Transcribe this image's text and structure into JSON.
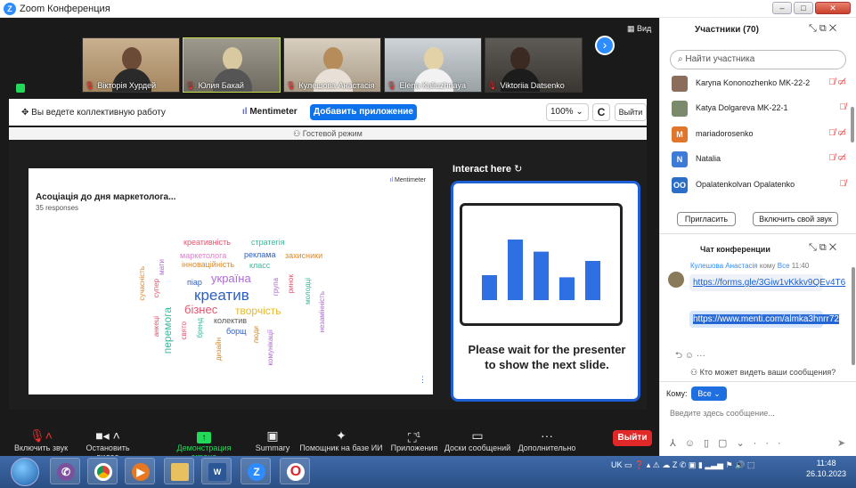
{
  "window": {
    "title": "Zoom Конференция",
    "buttons": [
      "–",
      "□",
      "✕"
    ]
  },
  "gallery": {
    "participants": [
      {
        "name": "Вікторія Хурдей"
      },
      {
        "name": "Юлия Бакай"
      },
      {
        "name": "Кулешова Анастасія"
      },
      {
        "name": "Elena Kaliuzhnaya"
      },
      {
        "name": "Viktoriia Datsenko"
      }
    ],
    "view_label": "Вид"
  },
  "collab": {
    "status_text": "Вы ведете коллективную работу",
    "app_name": "Mentimeter",
    "add_app_label": "Добавить приложение",
    "zoom_value": "100%",
    "exit_label": "Выйти",
    "guest_mode": "Гостевой режим"
  },
  "slide": {
    "brand": "Mentimeter",
    "title": "Асоціація до дня маркетолога...",
    "responses": "35 responses",
    "words": [
      {
        "text": "креатив",
        "color": "#2b5fc4"
      },
      {
        "text": "україна",
        "color": "#b06ad6"
      },
      {
        "text": "бізнес",
        "color": "#e2556d"
      },
      {
        "text": "творчість",
        "color": "#e6b830"
      },
      {
        "text": "перемога",
        "color": "#3cb89c"
      },
      {
        "text": "креативність",
        "color": "#e2556d"
      },
      {
        "text": "стратегія",
        "color": "#3cb89c"
      },
      {
        "text": "маркетолога",
        "color": "#e07bd0"
      },
      {
        "text": "реклама",
        "color": "#2b5fc4"
      },
      {
        "text": "захисники",
        "color": "#d98a2e"
      },
      {
        "text": "інноваційність",
        "color": "#d98a2e"
      },
      {
        "text": "класс",
        "color": "#3cb89c"
      },
      {
        "text": "піар",
        "color": "#2b5fc4"
      },
      {
        "text": "колектив",
        "color": "#555555"
      },
      {
        "text": "борщ",
        "color": "#2b5fc4"
      },
      {
        "text": "сучасність",
        "color": "#d98a2e"
      },
      {
        "text": "мати",
        "color": "#b06ad6"
      },
      {
        "text": "супер",
        "color": "#e2556d"
      },
      {
        "text": "свято",
        "color": "#e2556d"
      },
      {
        "text": "бренд",
        "color": "#3cb89c"
      },
      {
        "text": "дизайн",
        "color": "#d98a2e"
      },
      {
        "text": "група",
        "color": "#b06ad6"
      },
      {
        "text": "ринок",
        "color": "#e2556d"
      },
      {
        "text": "молодці",
        "color": "#3cb89c"
      },
      {
        "text": "незамінність",
        "color": "#b06ad6"
      },
      {
        "text": "люди",
        "color": "#d98a2e"
      },
      {
        "text": "комунікації",
        "color": "#b06ad6"
      },
      {
        "text": "анкеці",
        "color": "#e2556d"
      }
    ]
  },
  "interact": {
    "header": "Interact here",
    "message": "Please wait for the presenter to show the next slide.",
    "bars": [
      0.35,
      0.85,
      0.68,
      0.32,
      0.55
    ],
    "bar_color": "#2f6fe4"
  },
  "toolbar": {
    "items": [
      {
        "icon": "mic-muted-icon",
        "label": "Включить звук"
      },
      {
        "icon": "video-icon",
        "label": "Остановить видео"
      },
      {
        "icon": "share-screen-icon",
        "label": "Демонстрация экрана"
      },
      {
        "icon": "summary-icon",
        "label": "Summary"
      },
      {
        "icon": "ai-assistant-icon",
        "label": "Помощник на базе ИИ"
      },
      {
        "icon": "apps-icon",
        "label": "Приложения",
        "badge": "1"
      },
      {
        "icon": "whiteboard-icon",
        "label": "Доски сообщений"
      },
      {
        "icon": "more-icon",
        "label": "Дополнительно"
      }
    ],
    "leave_label": "Выйти",
    "share_color": "#23d959",
    "leave_color": "#e02828"
  },
  "participants": {
    "header": "Участники (70)",
    "search_placeholder": "Найти участника",
    "list": [
      {
        "name": "Karyna Kononozhenko MK-22-2",
        "avatar": "",
        "color": "#8a6d5a"
      },
      {
        "name": "Katya Dolgareva MK-22-1",
        "avatar": "",
        "color": "#7a8a6a"
      },
      {
        "name": "mariadorosenko",
        "avatar": "M",
        "color": "#e0752c"
      },
      {
        "name": "Natalia",
        "avatar": "N",
        "color": "#3e7bd6"
      },
      {
        "name": "Opalatenkolvan Opalatenko",
        "avatar": "OO",
        "color": "#2c6ec7"
      }
    ],
    "invite_label": "Пригласить",
    "unmute_label": "Включить свой звук"
  },
  "chat": {
    "header": "Чат конференции",
    "sender": "Кулешова Анастасія",
    "to_text": "кому",
    "to_target": "Все",
    "time": "11:40",
    "messages": [
      "https://forms.gle/3Giw1vKkkv9QEv4T6",
      "https://www.menti.com/almka3hnrr72"
    ],
    "who_can_see": "Кто может видеть ваши сообщения?",
    "to_label": "Кому:",
    "to_value": "Все",
    "input_placeholder": "Введите здесь сообщение..."
  },
  "taskbar": {
    "lang": "UK",
    "time": "11:48",
    "date": "26.10.2023"
  }
}
